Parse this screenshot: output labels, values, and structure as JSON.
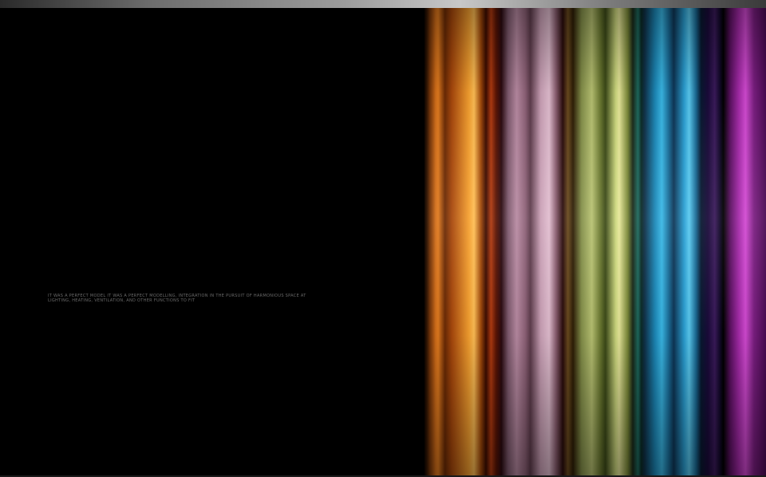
{
  "caption": {
    "line1": "IT WAS A PERFECT MODEL IT WAS A PERFECT MODELLING, INTEGRATION IN THE PURSUIT OF HARMONIOUS SPACE AT",
    "line2": "LIGHTING, HEATING, VENTILATION, AND OTHER FUNCTIONS TO FIT"
  },
  "colors": {
    "background": "#000000",
    "caption_text": "#6a6a6a"
  }
}
